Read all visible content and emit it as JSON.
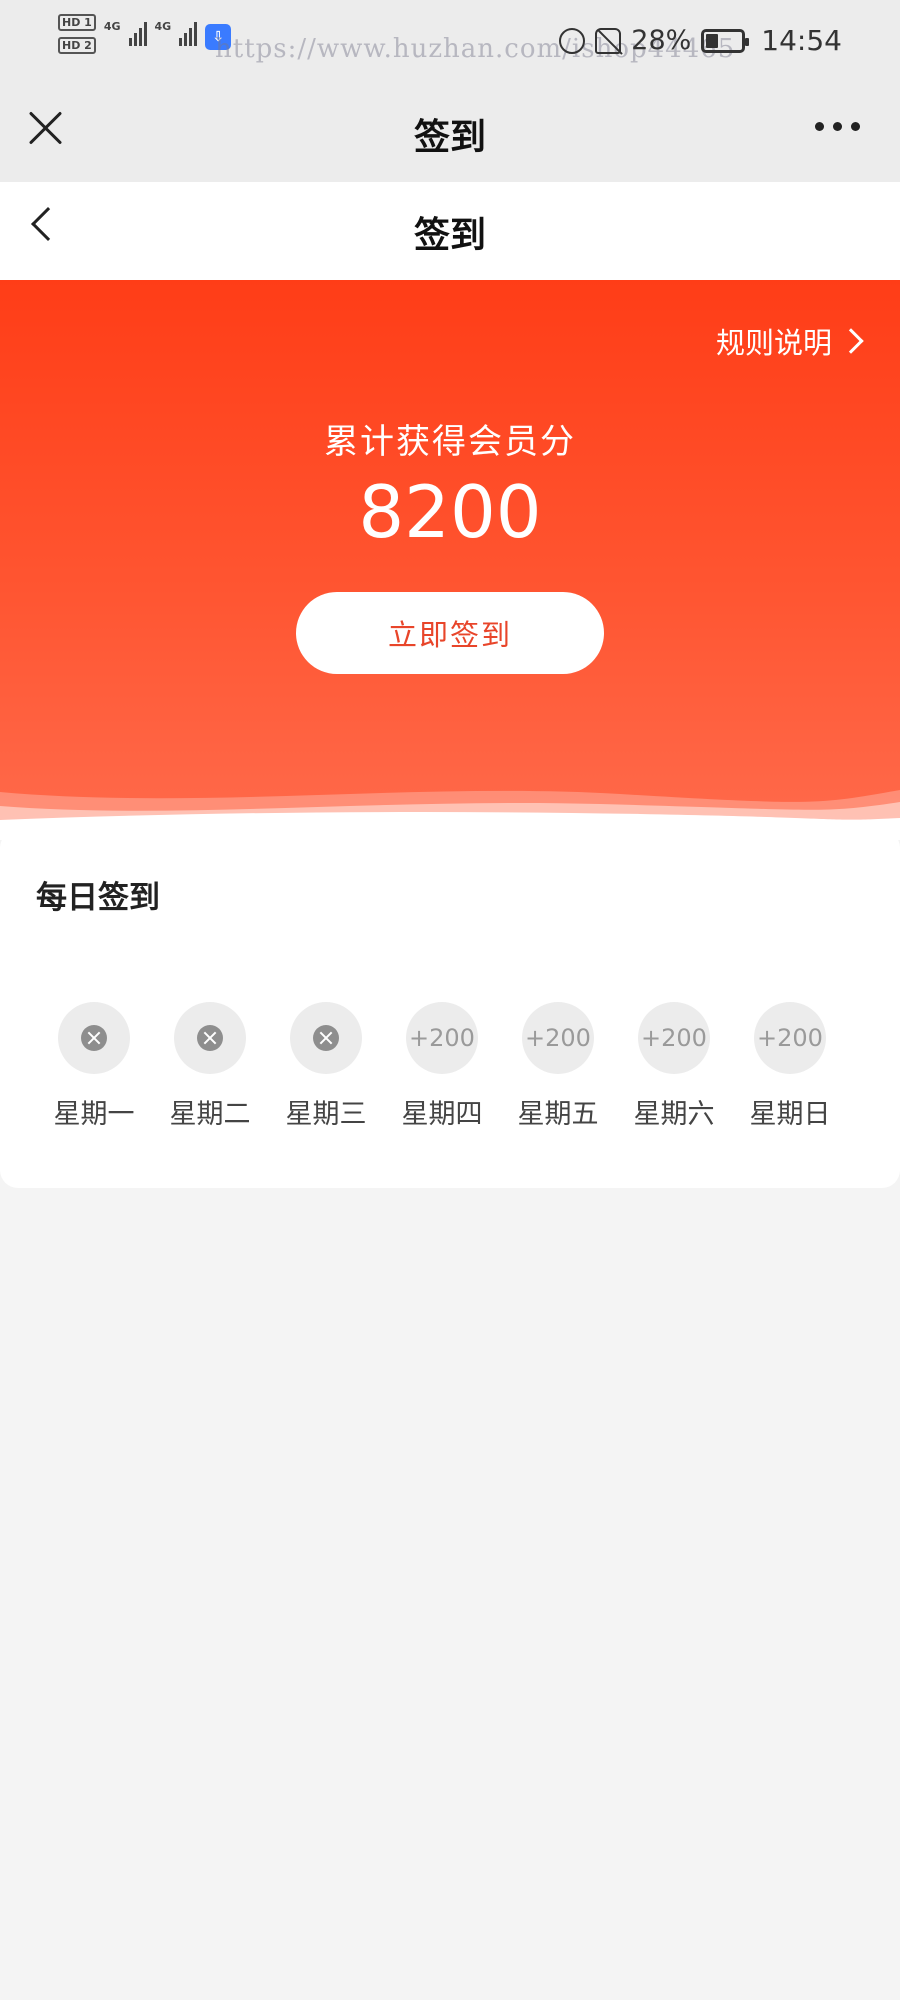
{
  "status_bar": {
    "hd1": "HD 1",
    "hd2": "HD 2",
    "net1": "4G",
    "net2": "4G",
    "watermark": "https://www.huzhan.com/ishop44465",
    "battery_pct": "28%",
    "time": "14:54",
    "icons": [
      "alarm-icon",
      "bell-off-icon",
      "battery-icon"
    ]
  },
  "outer_header": {
    "title": "签到"
  },
  "inner_header": {
    "title": "签到"
  },
  "hero": {
    "rules_label": "规则说明",
    "points_label": "累计获得会员分",
    "points_value": "8200",
    "checkin_button": "立即签到",
    "colors": {
      "gradient_top": "#ff3d17",
      "gradient_bottom": "#ff6b4c",
      "button_text": "#e8452a"
    }
  },
  "daily": {
    "title": "每日签到",
    "days": [
      {
        "label": "星期一",
        "status": "missed",
        "reward": ""
      },
      {
        "label": "星期二",
        "status": "missed",
        "reward": ""
      },
      {
        "label": "星期三",
        "status": "missed",
        "reward": ""
      },
      {
        "label": "星期四",
        "status": "pending",
        "reward": "+200"
      },
      {
        "label": "星期五",
        "status": "pending",
        "reward": "+200"
      },
      {
        "label": "星期六",
        "status": "pending",
        "reward": "+200"
      },
      {
        "label": "星期日",
        "status": "pending",
        "reward": "+200"
      }
    ]
  }
}
